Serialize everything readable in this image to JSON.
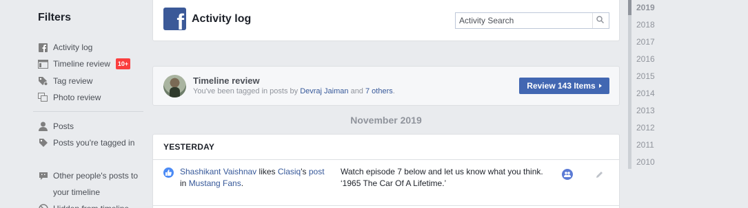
{
  "sidebar": {
    "title": "Filters",
    "items": [
      {
        "label": "Activity log",
        "icon": "facebook-square-icon"
      },
      {
        "label": "Timeline review",
        "icon": "timeline-icon",
        "badge": "10+"
      },
      {
        "label": "Tag review",
        "icon": "tag-review-icon"
      },
      {
        "label": "Photo review",
        "icon": "photo-review-icon"
      }
    ],
    "items2": [
      {
        "label": "Posts",
        "icon": "person-icon"
      },
      {
        "label": "Posts you're tagged in",
        "icon": "tag-icon"
      },
      {
        "label": "Other people's posts to your timeline",
        "icon": "comment-icon"
      },
      {
        "label": "Hidden from timeline",
        "icon": "hidden-icon"
      }
    ]
  },
  "header": {
    "title": "Activity log",
    "search_placeholder": "Activity Search"
  },
  "review": {
    "title": "Timeline review",
    "sub_prefix": "You've been tagged in posts by ",
    "sub_person": "Devraj Jaiman",
    "sub_mid": " and ",
    "sub_others": "7 others",
    "sub_suffix": ".",
    "button_label": "Review 143 Items"
  },
  "month_heading": "November 2019",
  "activity": {
    "section_label": "YESTERDAY",
    "row": {
      "actor": "Shashikant Vaishnav",
      "verb": " likes ",
      "target": "Clasiq",
      "possessive": "'s ",
      "object": "post",
      "prep": " in ",
      "group": "Mustang Fans",
      "end": ".",
      "content_line1": "Watch episode 7 below and let us know what you think.",
      "content_line2": "‘1965 The Car Of A Lifetime.’"
    }
  },
  "years": [
    "2019",
    "2018",
    "2017",
    "2016",
    "2015",
    "2014",
    "2013",
    "2012",
    "2011",
    "2010"
  ],
  "active_year": "2019",
  "colors": {
    "brand": "#3b5998",
    "button": "#4267b2",
    "badge": "#fa3e3e",
    "link": "#365899"
  }
}
